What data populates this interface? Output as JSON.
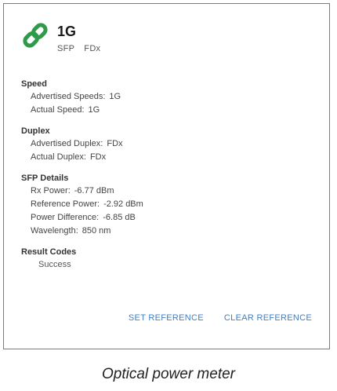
{
  "header": {
    "icon": "link-icon",
    "icon_color": "#2f9a4a",
    "title": "1G",
    "subtitle": [
      "SFP",
      "FDx"
    ]
  },
  "sections": {
    "speed": {
      "title": "Speed",
      "rows": [
        {
          "label": "Advertised Speeds",
          "value": "1G"
        },
        {
          "label": "Actual Speed",
          "value": "1G"
        }
      ]
    },
    "duplex": {
      "title": "Duplex",
      "rows": [
        {
          "label": "Advertised Duplex",
          "value": "FDx"
        },
        {
          "label": "Actual Duplex",
          "value": "FDx"
        }
      ]
    },
    "sfp": {
      "title": "SFP Details",
      "rows": [
        {
          "label": "Rx Power",
          "value": "-6.77 dBm"
        },
        {
          "label": "Reference Power",
          "value": "-2.92 dBm"
        },
        {
          "label": "Power Difference",
          "value": "-6.85 dB"
        },
        {
          "label": "Wavelength",
          "value": "850 nm"
        }
      ]
    },
    "result": {
      "title": "Result Codes",
      "value": "Success"
    }
  },
  "actions": {
    "set_reference": "SET REFERENCE",
    "clear_reference": "CLEAR REFERENCE",
    "accent_color": "#3d7fc9"
  },
  "caption": "Optical power meter"
}
